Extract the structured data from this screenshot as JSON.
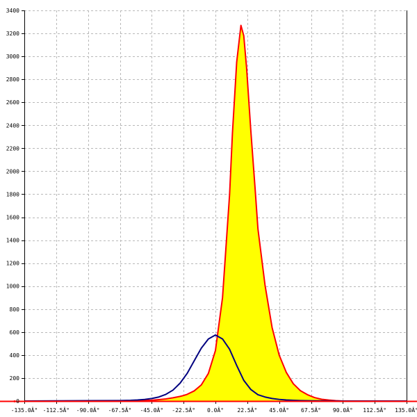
{
  "chart_data": {
    "type": "area",
    "title": "",
    "xlabel": "",
    "ylabel": "",
    "xlim": [
      -135,
      135
    ],
    "ylim": [
      0,
      3400
    ],
    "grid": true,
    "x_ticks": [
      -135,
      -112.5,
      -90,
      -67.5,
      -45,
      -22.5,
      0,
      22.5,
      45,
      67.5,
      90,
      112.5,
      135
    ],
    "x_tick_labels": [
      "-135.0Â°",
      "-112.5Â°",
      "-90.0Â°",
      "-67.5Â°",
      "-45.0Â°",
      "-22.5Â°",
      "0.0Â°",
      "22.5Â°",
      "45.0Â°",
      "67.5Â°",
      "90.0Â°",
      "112.5Â°",
      "135.0Â°"
    ],
    "y_ticks": [
      0,
      200,
      400,
      600,
      800,
      1000,
      1200,
      1400,
      1600,
      1800,
      2000,
      2200,
      2400,
      2600,
      2800,
      3000,
      3200,
      3400
    ],
    "y_tick_labels": [
      "0",
      "200",
      "400",
      "600",
      "800",
      "1000",
      "1200",
      "1400",
      "1600",
      "1800",
      "2000",
      "2200",
      "2400",
      "2600",
      "2800",
      "3000",
      "3200",
      "3400"
    ],
    "series": [
      {
        "color": "#ff0000",
        "fill": "#ffff00",
        "x": [
          -135,
          -90,
          -67.5,
          -60,
          -50,
          -45,
          -40,
          -35,
          -30,
          -25,
          -22.5,
          -20,
          -15,
          -10,
          -5,
          0,
          5,
          10,
          12,
          15,
          18,
          20,
          22,
          25,
          28,
          30,
          35,
          40,
          45,
          50,
          55,
          60,
          65,
          70,
          75,
          80,
          85,
          90,
          135
        ],
        "values": [
          0,
          0,
          2,
          3,
          5,
          7,
          12,
          18,
          28,
          40,
          48,
          58,
          88,
          140,
          240,
          440,
          900,
          1800,
          2330,
          2950,
          3270,
          3180,
          2900,
          2350,
          1850,
          1500,
          1010,
          640,
          400,
          250,
          150,
          90,
          55,
          30,
          15,
          8,
          3,
          0,
          0
        ]
      },
      {
        "color": "#000080",
        "x": [
          -135,
          -67.5,
          -60,
          -55,
          -50,
          -45,
          -40,
          -35,
          -30,
          -25,
          -20,
          -15,
          -10,
          -5,
          0,
          5,
          10,
          15,
          20,
          25,
          30,
          35,
          40,
          45,
          50,
          55,
          60,
          67.5,
          90,
          135
        ],
        "values": [
          0,
          4,
          6,
          9,
          14,
          22,
          35,
          58,
          95,
          155,
          240,
          350,
          460,
          540,
          575,
          540,
          450,
          310,
          180,
          100,
          55,
          35,
          22,
          14,
          9,
          6,
          4,
          2,
          0,
          0
        ]
      }
    ]
  }
}
